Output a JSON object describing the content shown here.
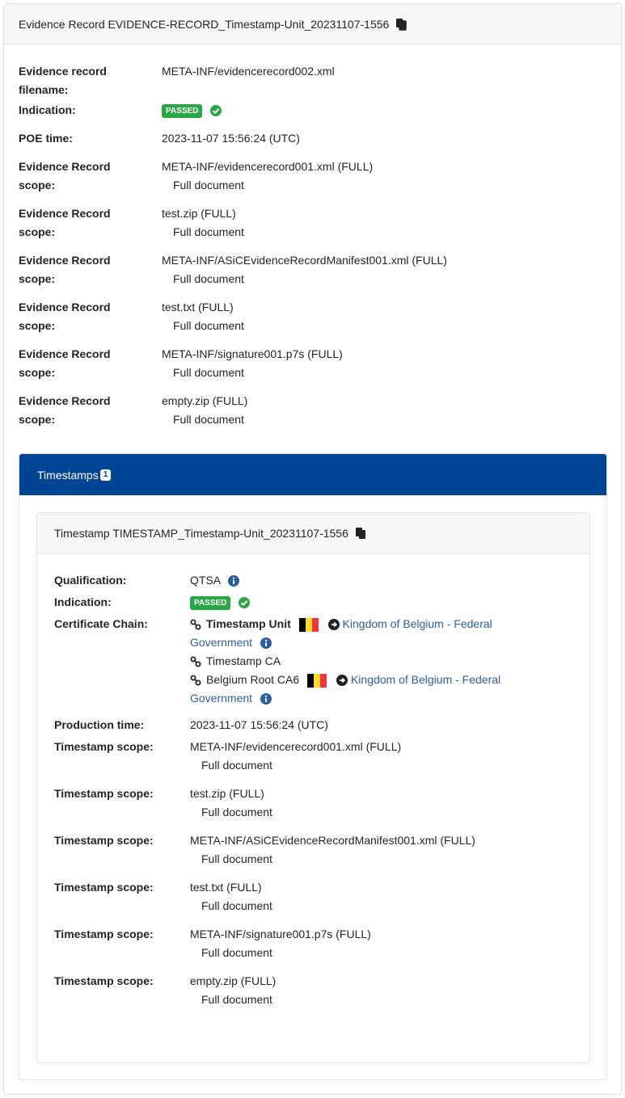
{
  "evidence_record": {
    "title": "Evidence Record EVIDENCE-RECORD_Timestamp-Unit_20231107-1556",
    "filename_label": "Evidence record filename:",
    "filename": "META-INF/evidencerecord002.xml",
    "indication_label": "Indication:",
    "indication": "PASSED",
    "poe_label": "POE time:",
    "poe_time": "2023-11-07 15:56:24 (UTC)",
    "scope_label": "Evidence Record scope:",
    "scopes": [
      {
        "name": "META-INF/evidencerecord001.xml (FULL)",
        "detail": "Full document"
      },
      {
        "name": "test.zip (FULL)",
        "detail": "Full document"
      },
      {
        "name": "META-INF/ASiCEvidenceRecordManifest001.xml (FULL)",
        "detail": "Full document"
      },
      {
        "name": "test.txt (FULL)",
        "detail": "Full document"
      },
      {
        "name": "META-INF/signature001.p7s (FULL)",
        "detail": "Full document"
      },
      {
        "name": "empty.zip (FULL)",
        "detail": "Full document"
      }
    ]
  },
  "timestamps": {
    "header": "Timestamps",
    "count": "1",
    "item": {
      "title": "Timestamp TIMESTAMP_Timestamp-Unit_20231107-1556",
      "qualification_label": "Qualification:",
      "qualification": "QTSA",
      "indication_label": "Indication:",
      "indication": "PASSED",
      "chain_label": "Certificate Chain:",
      "chain": [
        {
          "name": "Timestamp Unit",
          "bold": true,
          "country_link": "Kingdom of Belgium - Federal Government"
        },
        {
          "name": "Timestamp CA",
          "bold": false
        },
        {
          "name": "Belgium Root CA6",
          "bold": false,
          "country_link": "Kingdom of Belgium - Federal Government"
        }
      ],
      "production_label": "Production time:",
      "production_time": "2023-11-07 15:56:24 (UTC)",
      "scope_label": "Timestamp scope:",
      "scopes": [
        {
          "name": "META-INF/evidencerecord001.xml (FULL)",
          "detail": "Full document"
        },
        {
          "name": "test.zip (FULL)",
          "detail": "Full document"
        },
        {
          "name": "META-INF/ASiCEvidenceRecordManifest001.xml (FULL)",
          "detail": "Full document"
        },
        {
          "name": "test.txt (FULL)",
          "detail": "Full document"
        },
        {
          "name": "META-INF/signature001.p7s (FULL)",
          "detail": "Full document"
        },
        {
          "name": "empty.zip (FULL)",
          "detail": "Full document"
        }
      ]
    }
  },
  "colors": {
    "brand_blue": "#004494",
    "passed_green": "#28a745",
    "link_blue": "#2c5fa0",
    "flag_black": "#000000",
    "flag_yellow": "#fdda24",
    "flag_red": "#ef3340"
  },
  "icons": [
    "copy-icon",
    "check-circle-icon",
    "info-circle-icon",
    "chain-link-icon",
    "arrow-circle-right-icon",
    "belgium-flag-icon"
  ]
}
